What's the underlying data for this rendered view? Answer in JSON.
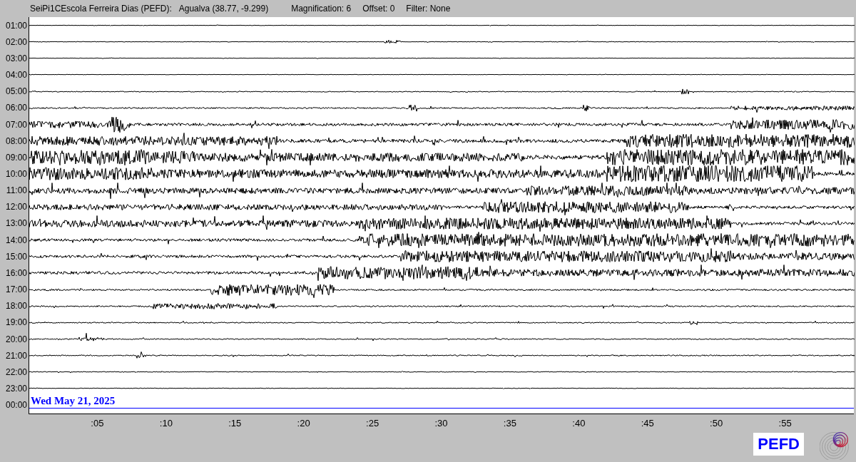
{
  "header": {
    "station": "SeiPi1CEscola Ferreira Dias (PEFD):",
    "location": "Agualva (38.77, -9.299)",
    "magnification": "Magnification: 6",
    "offset": "Offset: 0",
    "filter": "Filter: None"
  },
  "rows": [
    {
      "label": "01:00"
    },
    {
      "label": "02:00"
    },
    {
      "label": "03:00"
    },
    {
      "label": "04:00"
    },
    {
      "label": "05:00"
    },
    {
      "label": "06:00"
    },
    {
      "label": "07:00"
    },
    {
      "label": "08:00"
    },
    {
      "label": "09:00"
    },
    {
      "label": "10:00"
    },
    {
      "label": "11:00"
    },
    {
      "label": "12:00"
    },
    {
      "label": "13:00"
    },
    {
      "label": "14:00"
    },
    {
      "label": "15:00"
    },
    {
      "label": "16:00"
    },
    {
      "label": "17:00"
    },
    {
      "label": "18:00"
    },
    {
      "label": "19:00"
    },
    {
      "label": "20:00"
    },
    {
      "label": "21:00"
    },
    {
      "label": "22:00"
    },
    {
      "label": "23:00"
    },
    {
      "label": "00:00",
      "kind": "current"
    }
  ],
  "date_label": "Wed May 21, 2025",
  "x_ticks": [
    ":05",
    ":10",
    ":15",
    ":20",
    ":25",
    ":30",
    ":35",
    ":40",
    ":45",
    ":50",
    ":55"
  ],
  "logo_text": "PEFD"
}
